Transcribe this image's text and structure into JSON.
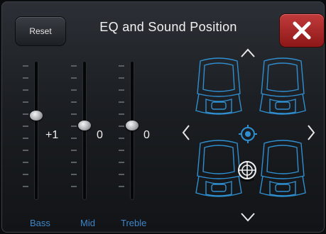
{
  "header": {
    "title": "EQ and Sound Position",
    "reset_label": "Reset"
  },
  "eq": {
    "bands": [
      {
        "label": "Bass",
        "value": "+1",
        "level": 1
      },
      {
        "label": "Mid",
        "value": "0",
        "level": 0
      },
      {
        "label": "Treble",
        "value": "0",
        "level": 0
      }
    ],
    "range": [
      -6,
      6
    ]
  },
  "colors": {
    "accent": "#3e86c7",
    "seat_outline": "#2f8fd0",
    "close": "#b32a2a"
  },
  "icons": {
    "close": "close-icon",
    "up": "chevron-up-icon",
    "down": "chevron-down-icon",
    "left": "chevron-left-icon",
    "right": "chevron-right-icon",
    "center": "target-icon",
    "position": "crosshair-icon"
  }
}
